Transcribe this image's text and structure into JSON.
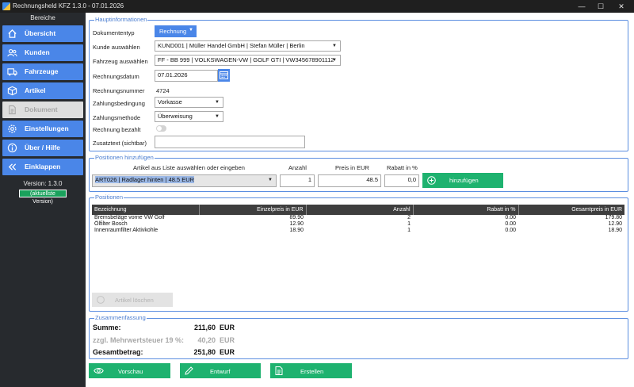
{
  "window": {
    "title": "Rechnungsheld KFZ 1.3.0   -   07.01.2026",
    "min": "—",
    "max": "☐",
    "close": "✕"
  },
  "sidebar": {
    "heading": "Bereiche",
    "items": [
      {
        "label": "Übersicht",
        "icon": "home-icon"
      },
      {
        "label": "Kunden",
        "icon": "users-icon"
      },
      {
        "label": "Fahrzeuge",
        "icon": "truck-icon"
      },
      {
        "label": "Artikel",
        "icon": "box-icon"
      },
      {
        "label": "Dokument",
        "icon": "document-icon"
      },
      {
        "label": "Einstellungen",
        "icon": "gear-icon"
      },
      {
        "label": "Über / Hilfe",
        "icon": "info-icon"
      },
      {
        "label": "Einklappen",
        "icon": "chevrons-left-icon"
      }
    ],
    "version": "Version: 1.3.0",
    "version_status": "(aktuellste Version)"
  },
  "haupt": {
    "title": "Hauptinformationen",
    "dokumenttyp_label": "Dokumententyp",
    "dokumenttyp_value": "Rechnung",
    "kunde_label": "Kunde auswählen",
    "kunde_value": "KUND001 | Müller Handel GmbH | Stefan Müller | Berlin",
    "fahrzeug_label": "Fahrzeug auswählen",
    "fahrzeug_value": "FF - BB 999 | VOLKSWAGEN-VW | GOLF GTI | VW345678901112",
    "datum_label": "Rechnungsdatum",
    "datum_value": "07.01.2026",
    "nummer_label": "Rechnungsnummer",
    "nummer_value": "4724",
    "zahlungsbed_label": "Zahlungsbedingung",
    "zahlungsbed_value": "Vorkasse",
    "zahlungsmeth_label": "Zahlungsmethode",
    "zahlungsmeth_value": "Überweisung",
    "bezahlt_label": "Rechnung bezahlt",
    "zusatz_label": "Zusatztext (sichtbar)",
    "zusatz_value": ""
  },
  "add": {
    "title": "Positionen hinzufügen",
    "artikel_label": "Artikel aus Liste auswählen oder eingeben",
    "artikel_value": "ART026 | Radlager hinten | 48.5 EUR",
    "anzahl_label": "Anzahl",
    "anzahl_value": "1",
    "preis_label": "Preis in EUR",
    "preis_value": "48.5",
    "rabatt_label": "Rabatt in %",
    "rabatt_value": "0,0",
    "add_button": "hinzufügen"
  },
  "positions": {
    "title": "Positionen",
    "columns": [
      "Bezeichnung",
      "Einzelpreis in EUR",
      "Anzahl",
      "Rabatt in %",
      "Gesamtpreis in EUR"
    ],
    "rows": [
      [
        "Bremsbeläge vorne VW Golf",
        "89.90",
        "2",
        "0.00",
        "179.80"
      ],
      [
        "Ölfilter Bosch",
        "12.90",
        "1",
        "0.00",
        "12.90"
      ],
      [
        "Innenraumfilter Aktivkohle",
        "18.90",
        "1",
        "0.00",
        "18.90"
      ]
    ],
    "delete_button": "Artikel löschen"
  },
  "summary": {
    "title": "Zusammenfassung",
    "summe_label": "Summe:",
    "summe_value": "211,60",
    "mwst_label": "zzgl. Mehrwertsteuer 19 %:",
    "mwst_value": "40,20",
    "gesamt_label": "Gesamtbetrag:",
    "gesamt_value": "251,80",
    "currency": "EUR"
  },
  "actions": {
    "vorschau": "Vorschau",
    "entwurf": "Entwurf",
    "erstellen": "Erstellen"
  },
  "colors": {
    "accent_blue": "#4a86e8",
    "accent_green": "#1eb26f",
    "sidebar_bg": "#272a2e"
  }
}
